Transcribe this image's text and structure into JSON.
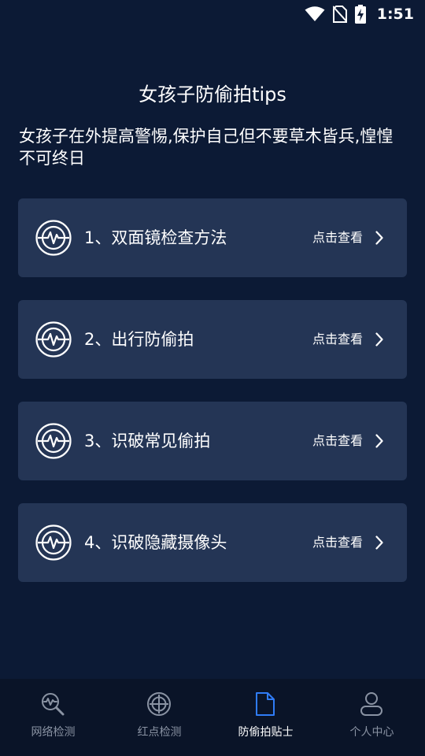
{
  "status_bar": {
    "time": "1:51",
    "icons": [
      "wifi-icon",
      "no-sim-icon",
      "battery-charging-icon"
    ]
  },
  "page": {
    "title": "女孩子防偷拍tips",
    "intro": "女孩子在外提高警惕,保护自己但不要草木皆兵,惶惶不可终日"
  },
  "tips": [
    {
      "label": "1、双面镜检查方法",
      "action": "点击查看",
      "icon": "radar-pulse-icon"
    },
    {
      "label": "2、出行防偷拍",
      "action": "点击查看",
      "icon": "radar-pulse-icon"
    },
    {
      "label": "3、识破常见偷拍",
      "action": "点击查看",
      "icon": "radar-pulse-icon"
    },
    {
      "label": "4、识破隐藏摄像头",
      "action": "点击查看",
      "icon": "radar-pulse-icon"
    }
  ],
  "bottom_nav": {
    "active_index": 2,
    "active_color": "#2f7cf6",
    "inactive_color": "#8a93a3",
    "items": [
      {
        "label": "网络检测",
        "icon": "network-scan-icon"
      },
      {
        "label": "红点检测",
        "icon": "crosshair-icon"
      },
      {
        "label": "防偷拍贴士",
        "icon": "document-icon"
      },
      {
        "label": "个人中心",
        "icon": "user-icon"
      }
    ]
  }
}
